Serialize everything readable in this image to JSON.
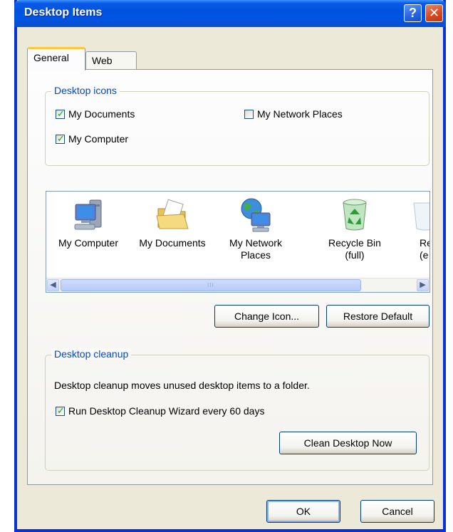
{
  "window": {
    "title": "Desktop Items",
    "help_glyph": "?",
    "close_glyph": "✕"
  },
  "tabs": [
    {
      "label": "General",
      "active": true
    },
    {
      "label": "Web",
      "active": false
    }
  ],
  "desktop_icons": {
    "legend": "Desktop icons",
    "checkboxes": [
      {
        "label": "My Documents",
        "checked": true
      },
      {
        "label": "My Computer",
        "checked": true
      },
      {
        "label": "My Network Places",
        "checked": false
      }
    ]
  },
  "icon_list": {
    "items": [
      {
        "icon": "my-computer-icon",
        "label": "My Computer"
      },
      {
        "icon": "my-documents-icon",
        "label": "My Documents"
      },
      {
        "icon": "my-network-places-icon",
        "label": "My Network\nPlaces"
      },
      {
        "icon": "recycle-bin-full-icon",
        "label": "Recycle Bin\n(full)"
      },
      {
        "icon": "recycle-bin-empty-icon",
        "label": "Rec\n(e"
      }
    ],
    "scroll_left": "◀",
    "scroll_right": "▶",
    "thumb_grip": "III"
  },
  "icon_buttons": {
    "change_icon": "Change Icon...",
    "restore_default": "Restore Default"
  },
  "desktop_cleanup": {
    "legend": "Desktop cleanup",
    "description": "Desktop cleanup moves unused desktop items to a folder.",
    "checkbox_label": "Run Desktop Cleanup Wizard every 60 days",
    "checkbox_checked": true,
    "clean_now": "Clean Desktop Now"
  },
  "footer": {
    "ok": "OK",
    "cancel": "Cancel"
  },
  "colors": {
    "title_blue": "#0153dd",
    "face": "#ece9d8",
    "legend_blue": "#0046d5",
    "check_green": "#21a121"
  }
}
